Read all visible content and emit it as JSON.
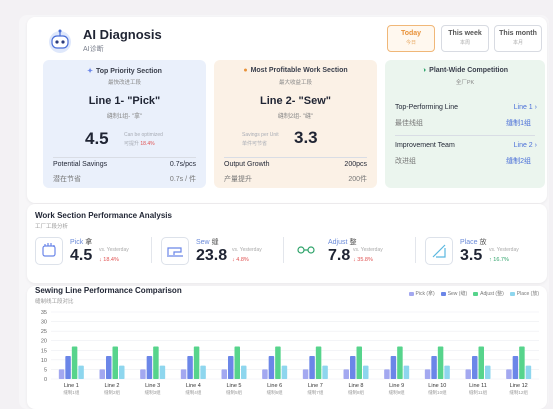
{
  "app": {
    "title": "AI Diagnosis",
    "subtitle": "AI诊断"
  },
  "periods": [
    {
      "label": "Today",
      "sub": "今日",
      "active": true
    },
    {
      "label": "This week",
      "sub": "本周",
      "active": false
    },
    {
      "label": "This month",
      "sub": "本月",
      "active": false
    }
  ],
  "priority": {
    "heading": "Top Priority Section",
    "heading_sub": "最快改进工段",
    "line": "Line 1- \"Pick\"",
    "line_sub": "缝制1组- \"拿\"",
    "value": "4.5",
    "note1": "Can be optimized",
    "note2": "可提升",
    "pct": "18.4%",
    "row1_label": "Potential Savings",
    "row1_value": "0.7s/pcs",
    "row2_label": "潜在节省",
    "row2_value": "0.7s / 件"
  },
  "profitable": {
    "heading": "Most Profitable Work Section",
    "heading_sub": "最大收益工段",
    "line": "Line 2- \"Sew\"",
    "line_sub": "缝制2组- \"缝\"",
    "note1": "Savings per Unit",
    "note2": "单件可节省",
    "value": "3.3",
    "row1_label": "Output Growth",
    "row1_value": "200pcs",
    "row2_label": "产量提升",
    "row2_value": "200件"
  },
  "competition": {
    "heading": "Plant-Wide Competition",
    "heading_sub": "全厂PK",
    "row1_label": "Top-Performing Line",
    "row1_value": "Line 1",
    "row2_label": "最佳线组",
    "row2_value": "缝制1组",
    "row3_label": "Improvement Team",
    "row3_value": "Line 2",
    "row4_label": "改进组",
    "row4_value": "缝制2组"
  },
  "analysis": {
    "title": "Work Section Performance Analysis",
    "subtitle": "工厂工段分析",
    "metrics": [
      {
        "name": "Pick",
        "cn": "拿",
        "value": "4.5",
        "vs": "vs. Yesterday",
        "change": "↓ 18.4%",
        "dir": "down"
      },
      {
        "name": "Sew",
        "cn": "缝",
        "value": "23.8",
        "vs": "vs. Yesterday",
        "change": "↓ 4.8%",
        "dir": "down"
      },
      {
        "name": "Adjust",
        "cn": "整",
        "value": "7.8",
        "vs": "vs. Yesterday",
        "change": "↓ 35.8%",
        "dir": "down"
      },
      {
        "name": "Place",
        "cn": "放",
        "value": "3.5",
        "vs": "vs. Yesterday",
        "change": "↑ 16.7%",
        "dir": "up"
      }
    ]
  },
  "chart_section": {
    "title": "Sewing Line Performance Comparison",
    "subtitle": "缝制线工段对比"
  },
  "colors": {
    "pick": "#a3a8f0",
    "sew": "#6b86e8",
    "adjust": "#57d48c",
    "place": "#8ed6ee"
  },
  "chart_data": {
    "type": "bar",
    "categories": [
      "Line 1",
      "Line 2",
      "Line 3",
      "Line 4",
      "Line 5",
      "Line 6",
      "Line 7",
      "Line 8",
      "Line 9",
      "Line 10",
      "Line 11",
      "Line 12"
    ],
    "category_sub": [
      "缝制1组",
      "缝制2组",
      "缝制3组",
      "缝制4组",
      "缝制5组",
      "缝制6组",
      "缝制7组",
      "缝制8组",
      "缝制9组",
      "缝制10组",
      "缝制11组",
      "缝制12组"
    ],
    "series": [
      {
        "name": "Pick (拿)",
        "values": [
          5,
          5,
          5,
          5,
          5,
          5,
          5,
          5,
          5,
          5,
          5,
          5
        ]
      },
      {
        "name": "Sew (缝)",
        "values": [
          12,
          12,
          12,
          12,
          12,
          12,
          12,
          12,
          12,
          12,
          12,
          12
        ]
      },
      {
        "name": "Adjust (整)",
        "values": [
          17,
          17,
          17,
          17,
          17,
          17,
          17,
          17,
          17,
          17,
          17,
          17
        ]
      },
      {
        "name": "Place (放)",
        "values": [
          7,
          7,
          7,
          7,
          7,
          7,
          7,
          7,
          7,
          7,
          7,
          7
        ]
      }
    ],
    "yticks": [
      0,
      5,
      10,
      15,
      20,
      25,
      30,
      35
    ],
    "ylim": [
      0,
      35
    ],
    "grid": true,
    "legend": "top-right"
  }
}
